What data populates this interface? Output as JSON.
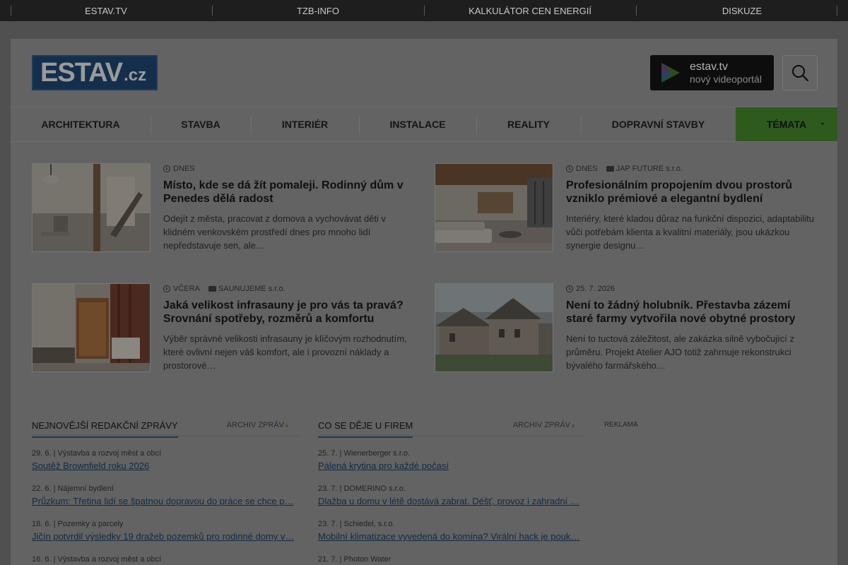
{
  "topbar": {
    "links": [
      "ESTAV.TV",
      "TZB-INFO",
      "KALKULÁTOR CEN ENERGIÍ",
      "DISKUZE"
    ]
  },
  "logo": {
    "main": "ESTAV",
    "suffix": ".cz"
  },
  "video_button": {
    "line1": "estav.tv",
    "line2": "nový videoportál"
  },
  "nav": {
    "items": [
      "ARCHITEKTURA",
      "STAVBA",
      "INTERIÉR",
      "INSTALACE",
      "REALITY",
      "DOPRAVNÍ STAVBY"
    ],
    "themes": "TÉMATA"
  },
  "articles": [
    {
      "date": "DNES",
      "company": "",
      "title": "Místo, kde se dá žít pomaleji. Rodinný dům v Penedes dělá radost",
      "perex": "Odejít z města, pracovat z domova a vychovávat děti v klidném venkovském prostředí dnes pro mnoho lidí nepředstavuje sen, ale…"
    },
    {
      "date": "DNES",
      "company": "JAP FUTURE s.r.o.",
      "title": "Profesionálním propojením dvou prostorů vzniklo prémiové a elegantní bydlení",
      "perex": "Interiéry, které kladou důraz na funkční dispozici, adaptabilitu vůči potřebám klienta a kvalitní materiály, jsou ukázkou synergie designu…"
    },
    {
      "date": "VČERA",
      "company": "SAUNUJEME s.r.o.",
      "title": "Jaká velikost infrasauny je pro vás ta pravá? Srovnání spotřeby, rozměrů a komfortu",
      "perex": "Výběr správné velikosti infrasauny je klíčovým rozhodnutím, které ovlivní nejen váš komfort, ale i provozní náklady a prostorové…"
    },
    {
      "date": "25. 7. 2026",
      "company": "",
      "title": "Není to žádný holubník. Přestavba zázemí staré farmy vytvořila nové obytné prostory",
      "perex": "Není to tuctová záležitost, ale zakázka silně vybočující z průměru. Projekt Atelier AJO totiž zahrnuje rekonstrukci bývalého farmářského…"
    }
  ],
  "news": {
    "title": "NEJNOVĚJŠÍ REDAKČNÍ ZPRÁVY",
    "archive": "ARCHIV ZPRÁV",
    "items": [
      {
        "meta": "29. 6. | Výstavba a rozvoj měst a obcí",
        "headline": "Soutěž Brownfield roku 2026"
      },
      {
        "meta": "22. 6. | Nájemní bydlení",
        "headline": "Průzkum: Třetina lidí se špatnou dopravou do práce se chce p…"
      },
      {
        "meta": "18. 6. | Pozemky a parcely",
        "headline": "Jičín potvrdil výsledky 19 dražeb pozemků pro rodinné domy v…"
      },
      {
        "meta": "16. 6. | Výstavba a rozvoj měst a obcí",
        "headline": ""
      }
    ]
  },
  "firms": {
    "title": "CO SE DĚJE U FIREM",
    "archive": "ARCHIV ZPRÁV",
    "items": [
      {
        "meta": "25. 7. | Wienerberger s.r.o.",
        "headline": "Pálená krytina pro každé počasí"
      },
      {
        "meta": "23. 7. | DOMERINO s.r.o.",
        "headline": "Dlažba u domu v létě dostává zabrat. Déšť, provoz i zahradní …"
      },
      {
        "meta": "23. 7. | Schiedel, s.r.o.",
        "headline": "Mobilní klimatizace vyvedená do komína? Virální hack je pouk…"
      },
      {
        "meta": "21. 7. | Photon Water",
        "headline": ""
      }
    ]
  },
  "ad_label": "REKLAMA",
  "colors": {
    "topbar": "#1e1e1e",
    "page_background": "#505050",
    "panel": "#636363",
    "logo_background": "#142f4c",
    "theme_accent": "#2e5a1e",
    "link": "#112a44"
  }
}
